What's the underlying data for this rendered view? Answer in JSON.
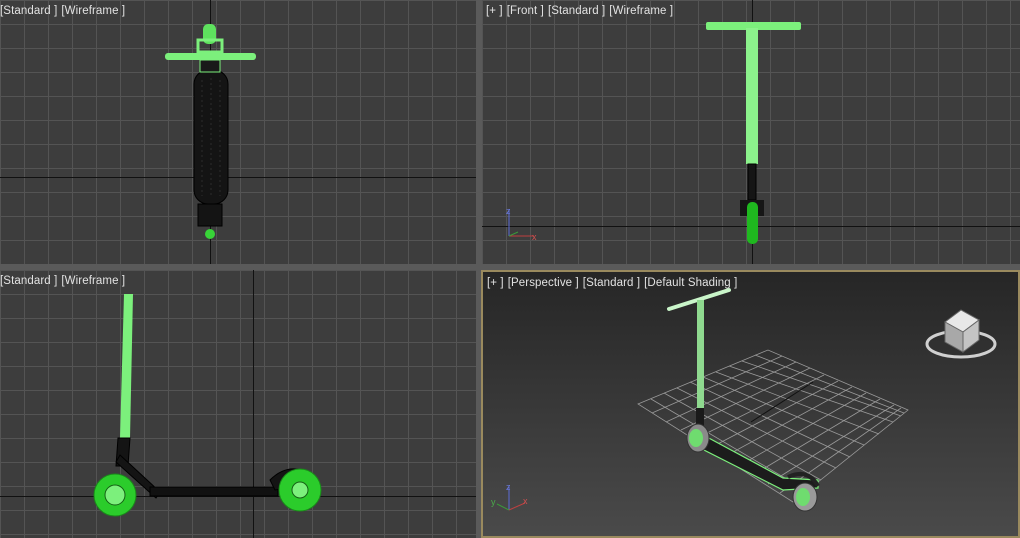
{
  "viewports": {
    "top": {
      "labels": [
        "[Standard ]",
        "[Wireframe ]"
      ]
    },
    "front": {
      "labels": [
        "[+ ]",
        "[Front ]",
        "[Standard ]",
        "[Wireframe ]"
      ]
    },
    "left": {
      "labels": [
        "[Standard ]",
        "[Wireframe ]"
      ]
    },
    "perspective": {
      "labels": [
        "[+ ]",
        "[Perspective ]",
        "[Standard ]",
        "[Default Shading ]"
      ],
      "active": true
    }
  },
  "axis_gizmo": {
    "x": "x",
    "y": "y",
    "z": "z"
  },
  "colors": {
    "selection_green": "#7cf07c",
    "wire_dark": "#121212",
    "viewport_bg": "#3d3d3d",
    "grid": "#545454",
    "active_border": "#9a8a5e"
  },
  "icons": {
    "viewcube": "viewcube-icon",
    "axis": "axis-tripod-icon"
  }
}
